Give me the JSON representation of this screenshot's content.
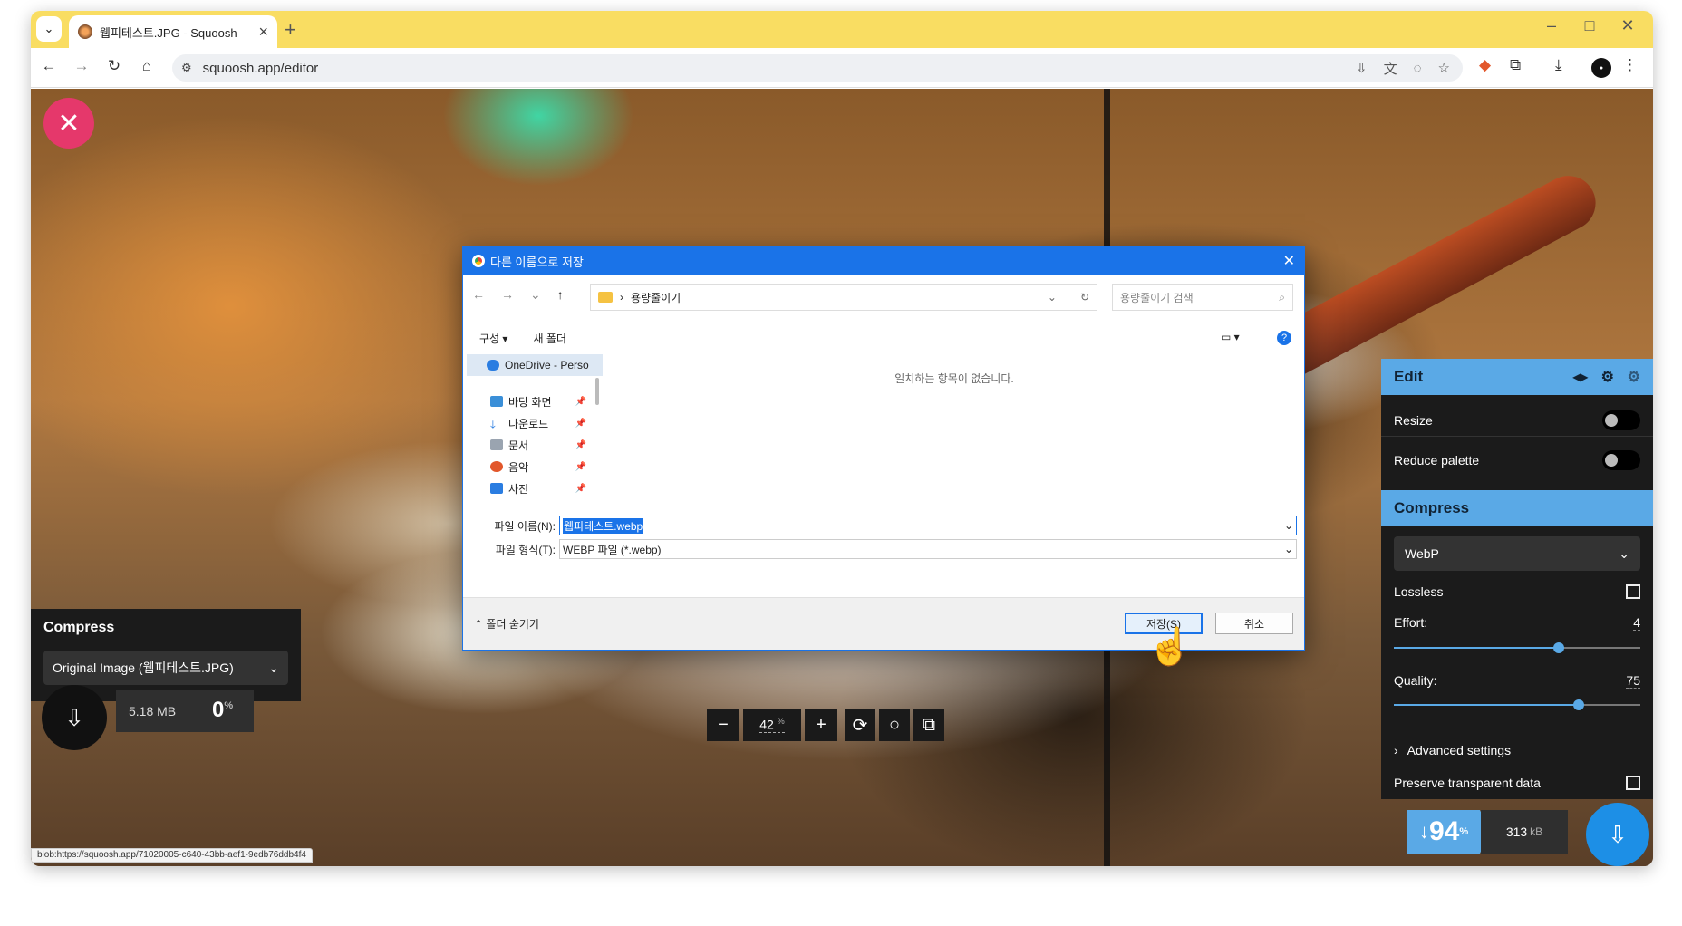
{
  "browser": {
    "tab_title": "웹피테스트.JPG - Squoosh",
    "url": "squoosh.app/editor",
    "status_url": "blob:https://squoosh.app/71020005-c640-43bb-aef1-9edb76ddb4f4"
  },
  "left_panel": {
    "title": "Compress",
    "select_value": "Original Image (웹피테스트.JPG)",
    "size": "5.18 MB",
    "percent": "0",
    "percent_unit": "%"
  },
  "zoom": {
    "value": "42",
    "unit": "%"
  },
  "right_panel": {
    "edit_title": "Edit",
    "resize_label": "Resize",
    "reduce_palette_label": "Reduce palette",
    "compress_title": "Compress",
    "format_value": "WebP",
    "lossless_label": "Lossless",
    "effort_label": "Effort:",
    "effort_value": "4",
    "effort_level": 0.67,
    "quality_label": "Quality:",
    "quality_value": "75",
    "quality_level": 0.75,
    "advanced_label": "Advanced settings",
    "preserve_label": "Preserve transparent data",
    "reduction_percent": "94",
    "reduction_unit": "%",
    "output_size": "313",
    "output_unit": "kB"
  },
  "dialog": {
    "title": "다른 이름으로 저장",
    "path_folder": "용량줄이기",
    "search_placeholder": "용량줄이기 검색",
    "organize_label": "구성 ▾",
    "new_folder_label": "새 폴더",
    "onedrive_label": "OneDrive - Perso",
    "nav_items": [
      "바탕 화면",
      "다운로드",
      "문서",
      "음악",
      "사진"
    ],
    "empty_message": "일치하는 항목이 없습니다.",
    "filename_label": "파일 이름(N):",
    "filename_value": "웹피테스트.webp",
    "filetype_label": "파일 형식(T):",
    "filetype_value": "WEBP 파일 (*.webp)",
    "hide_folders_label": "폴더 숨기기",
    "save_label": "저장(S)",
    "cancel_label": "취소"
  },
  "colors": {
    "accent_blue": "#5aa9e6",
    "close_pink": "#e5386b",
    "titlebar_yellow": "#f9dd62",
    "dialog_blue": "#1a73e8"
  }
}
